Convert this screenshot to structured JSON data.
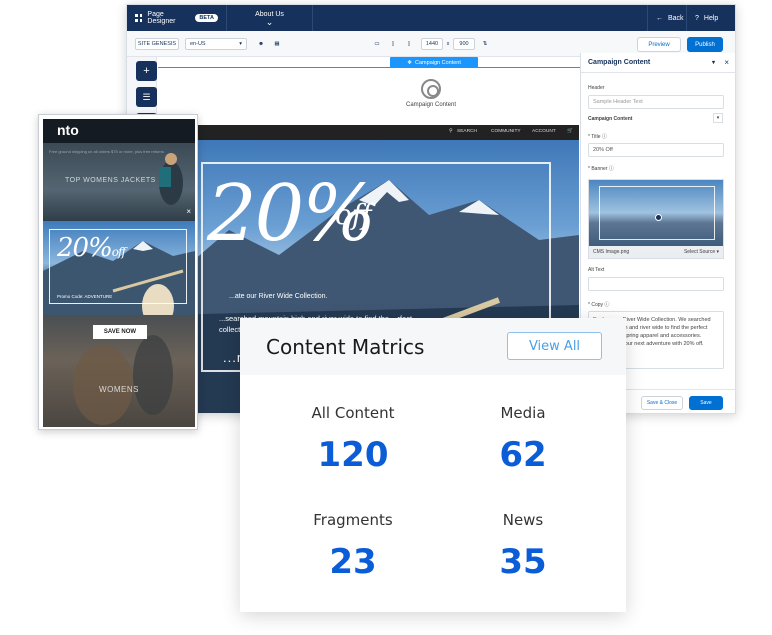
{
  "editor": {
    "app_title": "Page Designer",
    "beta_badge": "BETA",
    "page_name": "About Us",
    "back_label": "Back",
    "help_label": "Help",
    "site_badge": "SITE GENESIS",
    "locale": "en-US",
    "width_value": "1440",
    "height_value": "900",
    "preview_label": "Preview",
    "publish_label": "Publish",
    "region_label": "Campaign Content",
    "component_title": "Campaign Content",
    "site_nav": [
      "SEARCH",
      "COMMUNITY",
      "ACCOUNT"
    ],
    "hero": {
      "big": "20%",
      "off": "off",
      "subtitle": "...ate our River Wide Collection.",
      "body": "...searched mountain high and river wide to find the ...rfect collection ... your next adve...",
      "promo": "...mo Co..."
    }
  },
  "panel": {
    "title": "Campaign Content",
    "header_label": "Header",
    "header_placeholder": "Sample Header Text",
    "select_label": "Campaign Content",
    "title_label": "* Title",
    "title_value": "20% Off",
    "banner_label": "* Banner",
    "image_name": "CMS Image.png",
    "select_source": "Select Source ▾",
    "alt_label": "Alt Text",
    "copy_label": "* Copy",
    "copy_text": "Explore our River Wide Collection. We searched mountain high and river wide to find the perfect collection of spring apparel and accessories. Prepare for your next adventure with 20% off.",
    "save_close": "Save & Close",
    "save": "Save"
  },
  "mobile": {
    "logo": "nto",
    "tiny_text": "Free ground shipping on all orders $75 or more, plus free returns",
    "section1_text": "TOP WOMENS JACKETS",
    "big": "20%",
    "off": "off",
    "promo_code": "Promo Code: ADVENTURE",
    "save_now": "SAVE NOW",
    "women": "WOMENS"
  },
  "metrics": {
    "title": "Content Matrics",
    "view_all": "View All",
    "items": [
      {
        "label": "All Content",
        "value": "120"
      },
      {
        "label": "Media",
        "value": "62"
      },
      {
        "label": "Fragments",
        "value": "23"
      },
      {
        "label": "News",
        "value": "35"
      }
    ]
  },
  "colors": {
    "nav": "#16325c",
    "accent": "#0070d2",
    "metric_value": "#0b5cd7"
  }
}
